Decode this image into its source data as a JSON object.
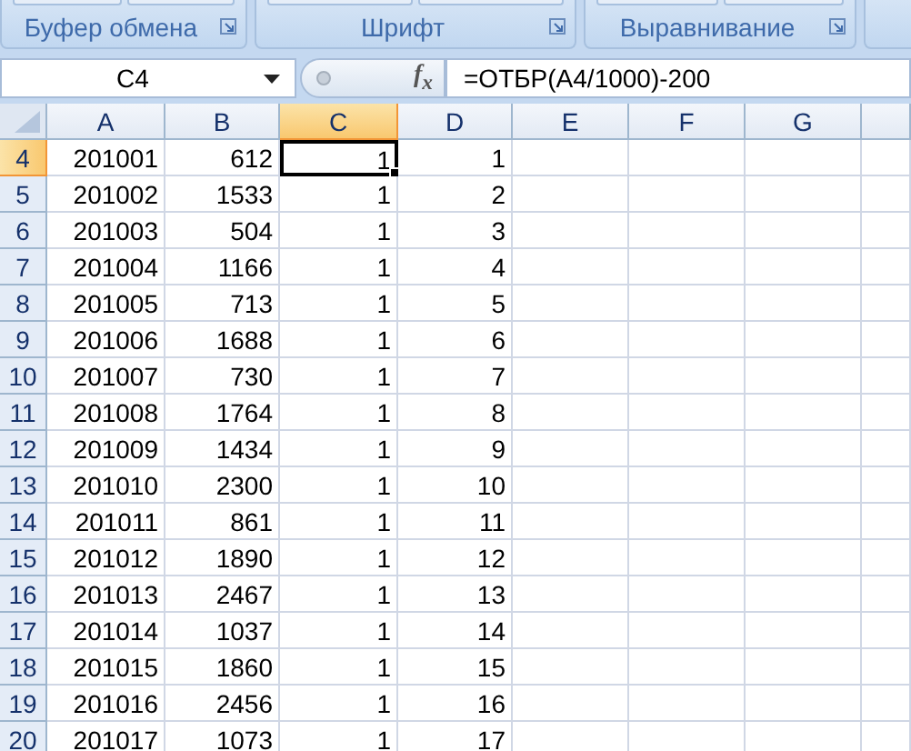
{
  "ribbon": {
    "groups": [
      {
        "label": "Буфер обмена"
      },
      {
        "label": "Шрифт"
      },
      {
        "label": "Выравнивание"
      }
    ]
  },
  "formula_bar": {
    "name_box": "C4",
    "function_label": "f$_{x}$",
    "formula": "=ОТБР(A4/1000)-200"
  },
  "columns": [
    {
      "label": "A",
      "selected": false
    },
    {
      "label": "B",
      "selected": false
    },
    {
      "label": "C",
      "selected": true
    },
    {
      "label": "D",
      "selected": false
    },
    {
      "label": "E",
      "selected": false
    },
    {
      "label": "F",
      "selected": false
    },
    {
      "label": "G",
      "selected": false
    }
  ],
  "rows": [
    {
      "number": "4",
      "selected": true,
      "cells": [
        {
          "text": "201001",
          "selected": false
        },
        {
          "text": "612",
          "selected": false
        },
        {
          "text": "1",
          "selected": true
        },
        {
          "text": "1",
          "selected": false
        }
      ]
    },
    {
      "number": "5",
      "selected": false,
      "cells": [
        {
          "text": "201002",
          "selected": false
        },
        {
          "text": "1533",
          "selected": false
        },
        {
          "text": "1",
          "selected": false
        },
        {
          "text": "2",
          "selected": false
        }
      ]
    },
    {
      "number": "6",
      "selected": false,
      "cells": [
        {
          "text": "201003",
          "selected": false
        },
        {
          "text": "504",
          "selected": false
        },
        {
          "text": "1",
          "selected": false
        },
        {
          "text": "3",
          "selected": false
        }
      ]
    },
    {
      "number": "7",
      "selected": false,
      "cells": [
        {
          "text": "201004",
          "selected": false
        },
        {
          "text": "1166",
          "selected": false
        },
        {
          "text": "1",
          "selected": false
        },
        {
          "text": "4",
          "selected": false
        }
      ]
    },
    {
      "number": "8",
      "selected": false,
      "cells": [
        {
          "text": "201005",
          "selected": false
        },
        {
          "text": "713",
          "selected": false
        },
        {
          "text": "1",
          "selected": false
        },
        {
          "text": "5",
          "selected": false
        }
      ]
    },
    {
      "number": "9",
      "selected": false,
      "cells": [
        {
          "text": "201006",
          "selected": false
        },
        {
          "text": "1688",
          "selected": false
        },
        {
          "text": "1",
          "selected": false
        },
        {
          "text": "6",
          "selected": false
        }
      ]
    },
    {
      "number": "10",
      "selected": false,
      "cells": [
        {
          "text": "201007",
          "selected": false
        },
        {
          "text": "730",
          "selected": false
        },
        {
          "text": "1",
          "selected": false
        },
        {
          "text": "7",
          "selected": false
        }
      ]
    },
    {
      "number": "11",
      "selected": false,
      "cells": [
        {
          "text": "201008",
          "selected": false
        },
        {
          "text": "1764",
          "selected": false
        },
        {
          "text": "1",
          "selected": false
        },
        {
          "text": "8",
          "selected": false
        }
      ]
    },
    {
      "number": "12",
      "selected": false,
      "cells": [
        {
          "text": "201009",
          "selected": false
        },
        {
          "text": "1434",
          "selected": false
        },
        {
          "text": "1",
          "selected": false
        },
        {
          "text": "9",
          "selected": false
        }
      ]
    },
    {
      "number": "13",
      "selected": false,
      "cells": [
        {
          "text": "201010",
          "selected": false
        },
        {
          "text": "2300",
          "selected": false
        },
        {
          "text": "1",
          "selected": false
        },
        {
          "text": "10",
          "selected": false
        }
      ]
    },
    {
      "number": "14",
      "selected": false,
      "cells": [
        {
          "text": "201011",
          "selected": false
        },
        {
          "text": "861",
          "selected": false
        },
        {
          "text": "1",
          "selected": false
        },
        {
          "text": "11",
          "selected": false
        }
      ]
    },
    {
      "number": "15",
      "selected": false,
      "cells": [
        {
          "text": "201012",
          "selected": false
        },
        {
          "text": "1890",
          "selected": false
        },
        {
          "text": "1",
          "selected": false
        },
        {
          "text": "12",
          "selected": false
        }
      ]
    },
    {
      "number": "16",
      "selected": false,
      "cells": [
        {
          "text": "201013",
          "selected": false
        },
        {
          "text": "2467",
          "selected": false
        },
        {
          "text": "1",
          "selected": false
        },
        {
          "text": "13",
          "selected": false
        }
      ]
    },
    {
      "number": "17",
      "selected": false,
      "cells": [
        {
          "text": "201014",
          "selected": false
        },
        {
          "text": "1037",
          "selected": false
        },
        {
          "text": "1",
          "selected": false
        },
        {
          "text": "14",
          "selected": false
        }
      ]
    },
    {
      "number": "18",
      "selected": false,
      "cells": [
        {
          "text": "201015",
          "selected": false
        },
        {
          "text": "1860",
          "selected": false
        },
        {
          "text": "1",
          "selected": false
        },
        {
          "text": "15",
          "selected": false
        }
      ]
    },
    {
      "number": "19",
      "selected": false,
      "cells": [
        {
          "text": "201016",
          "selected": false
        },
        {
          "text": "2456",
          "selected": false
        },
        {
          "text": "1",
          "selected": false
        },
        {
          "text": "16",
          "selected": false
        }
      ]
    },
    {
      "number": "20",
      "selected": false,
      "cells": [
        {
          "text": "201017",
          "selected": false
        },
        {
          "text": "1073",
          "selected": false
        },
        {
          "text": "1",
          "selected": false
        },
        {
          "text": "17",
          "selected": false
        }
      ]
    }
  ]
}
